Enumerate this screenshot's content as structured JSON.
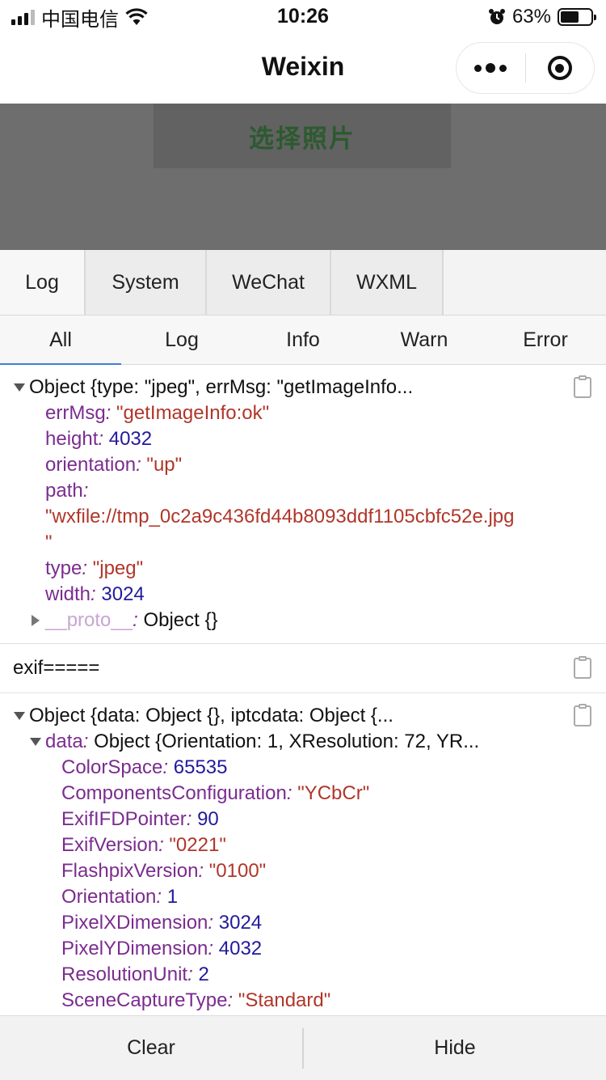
{
  "status_bar": {
    "carrier": "中国电信",
    "time": "10:26",
    "battery_percent": "63%",
    "battery_level": 0.63,
    "icons": [
      "signal-icon",
      "wifi-icon",
      "alarm-icon",
      "battery-icon"
    ]
  },
  "nav": {
    "title": "Weixin",
    "capsule_icons": [
      "more-dots-icon",
      "close-target-icon"
    ]
  },
  "page": {
    "choose_photo_label": "选择照片"
  },
  "vconsole": {
    "tabs": [
      "Log",
      "System",
      "WeChat",
      "WXML"
    ],
    "active_tab": "Log",
    "filters": [
      "All",
      "Log",
      "Info",
      "Warn",
      "Error"
    ],
    "active_filter": "All",
    "entries": {
      "e1": {
        "header": "Object {type: \"jpeg\", errMsg: \"getImageInfo...",
        "props": {
          "errMsg": {
            "key": "errMsg",
            "value": "\"getImageInfo:ok\""
          },
          "height": {
            "key": "height",
            "value": "4032"
          },
          "orientation": {
            "key": "orientation",
            "value": "\"up\""
          },
          "path": {
            "key": "path",
            "value_line1": "\"wxfile://tmp_0c2a9c436fd44b8093ddf1105cbfc52e.jpg",
            "value_line2": "\""
          },
          "type": {
            "key": "type",
            "value": "\"jpeg\""
          },
          "width": {
            "key": "width",
            "value": "3024"
          },
          "proto": {
            "key": "__proto__",
            "value": "Object {}"
          }
        }
      },
      "e2": {
        "text": "exif====="
      },
      "e3": {
        "header": "Object {data: Object {}, iptcdata: Object {...",
        "data": {
          "key": "data",
          "value": "Object {Orientation: 1, XResolution: 72, YR..."
        },
        "props": [
          {
            "key": "ColorSpace",
            "value": "65535",
            "kind": "n"
          },
          {
            "key": "ComponentsConfiguration",
            "value": "\"YCbCr\"",
            "kind": "s"
          },
          {
            "key": "ExifIFDPointer",
            "value": "90",
            "kind": "n"
          },
          {
            "key": "ExifVersion",
            "value": "\"0221\"",
            "kind": "s"
          },
          {
            "key": "FlashpixVersion",
            "value": "\"0100\"",
            "kind": "s"
          },
          {
            "key": "Orientation",
            "value": "1",
            "kind": "n"
          },
          {
            "key": "PixelXDimension",
            "value": "3024",
            "kind": "n"
          },
          {
            "key": "PixelYDimension",
            "value": "4032",
            "kind": "n"
          },
          {
            "key": "ResolutionUnit",
            "value": "2",
            "kind": "n"
          },
          {
            "key": "SceneCaptureType",
            "value": "\"Standard\"",
            "kind": "s"
          }
        ]
      }
    },
    "bottom": {
      "clear": "Clear",
      "hide": "Hide"
    }
  }
}
